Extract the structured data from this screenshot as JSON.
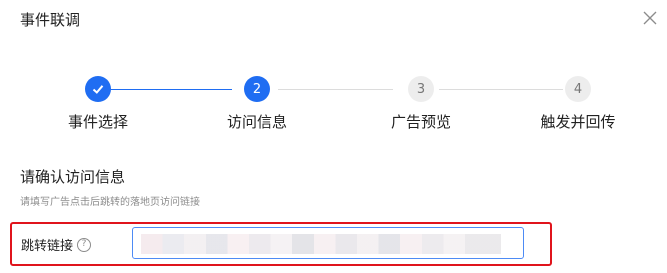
{
  "dialog": {
    "title": "事件联调"
  },
  "steps": [
    {
      "number": "1",
      "label": "事件选择",
      "status": "done"
    },
    {
      "number": "2",
      "label": "访问信息",
      "status": "active"
    },
    {
      "number": "3",
      "label": "广告预览",
      "status": "wait"
    },
    {
      "number": "4",
      "label": "触发并回传",
      "status": "wait"
    }
  ],
  "section": {
    "title": "请确认访问信息",
    "hint": "请填写广告点击后跳转的落地页访问链接"
  },
  "link_field": {
    "label": "跳转链接",
    "help_icon": "question-circle-icon",
    "value_obscured": true
  },
  "colors": {
    "accent": "#1f6df2",
    "highlight_border": "#e0141c",
    "inactive_step": "#ededed"
  }
}
